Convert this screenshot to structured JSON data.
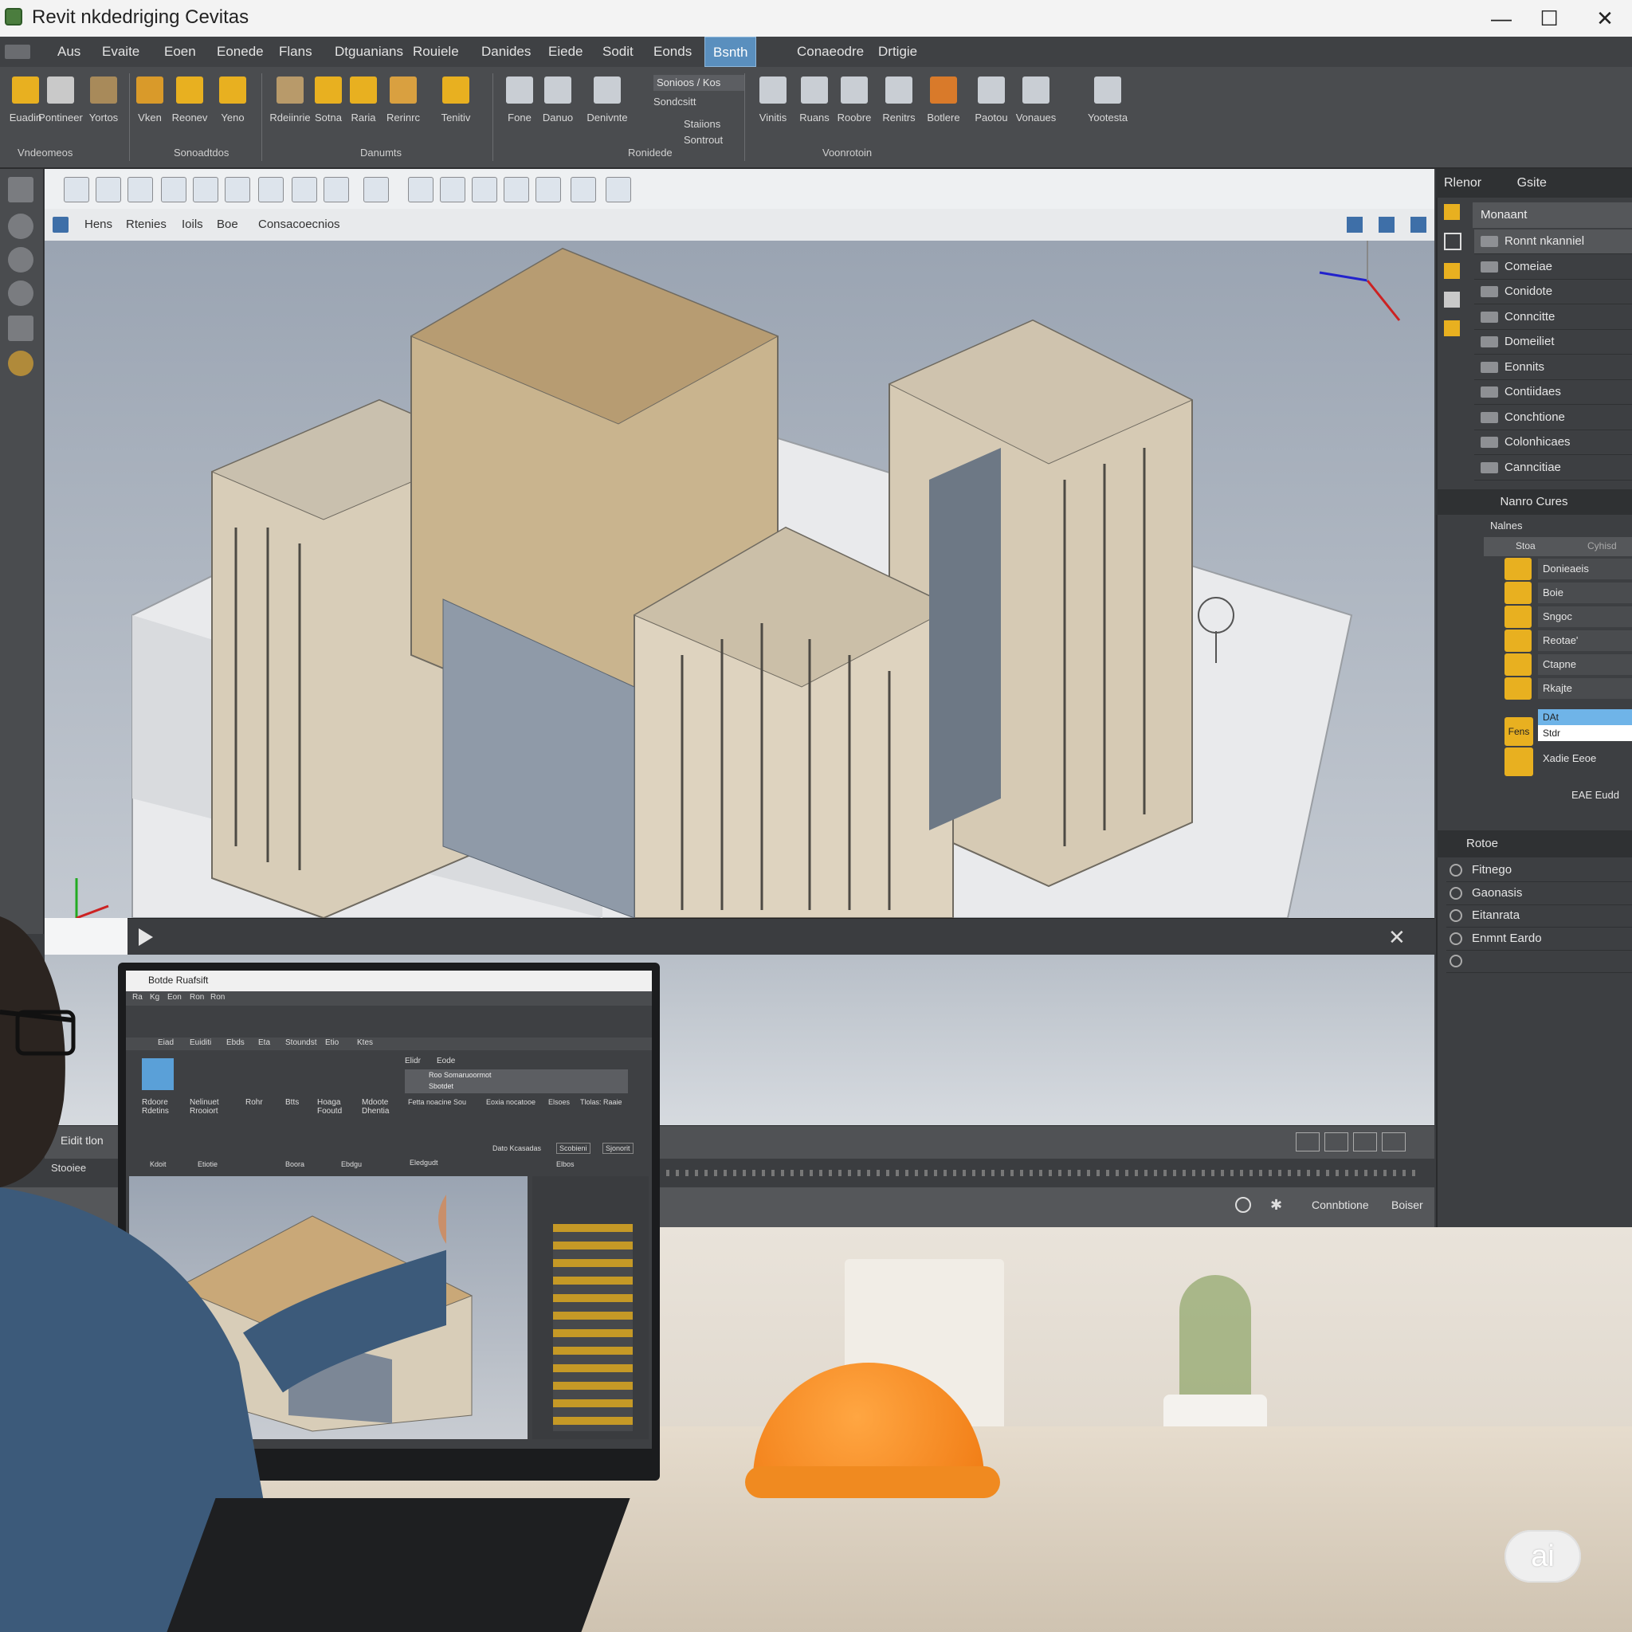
{
  "window": {
    "title": "Revit nkdedriging Cevitas",
    "controls": {
      "minimize": "—",
      "maximize": "☐",
      "close": "✕"
    }
  },
  "menu": {
    "items": [
      "Aus",
      "Evaite",
      "Eoen",
      "Eonede",
      "Flans",
      "Dtguanians",
      "Rouiele",
      "Danides",
      "Eiede",
      "Sodit",
      "Eonds",
      "Bsnth",
      "Conaeodre",
      "Drtigie"
    ],
    "active_index": 11
  },
  "ribbon": {
    "tools": [
      {
        "label": "Euadin",
        "color": "#e8b020"
      },
      {
        "label": "Pontineer",
        "color": "#c9c9c9"
      },
      {
        "label": "Yortos",
        "color": "#a88a5a"
      },
      {
        "label": "Vken",
        "color": "#d99a2a"
      },
      {
        "label": "Reonev",
        "color": "#e8b020"
      },
      {
        "label": "Yeno",
        "color": "#e8b020"
      },
      {
        "label": "Rdeiinrie",
        "color": "#b89a6a"
      },
      {
        "label": "Sotna",
        "color": "#e8b020"
      },
      {
        "label": "Raria",
        "color": "#e8b020"
      },
      {
        "label": "Rerinrc",
        "color": "#d9a040"
      },
      {
        "label": "Tenitiv",
        "color": "#e8b020"
      },
      {
        "label": "Fone",
        "color": "#c9ced4"
      },
      {
        "label": "Danuo",
        "color": "#c9ced4"
      },
      {
        "label": "Denivnte",
        "color": "#c9ced4"
      },
      {
        "label": "Vinitis",
        "color": "#c9ced4"
      },
      {
        "label": "Ruans",
        "color": "#c9ced4"
      },
      {
        "label": "Roobre",
        "color": "#c9ced4"
      },
      {
        "label": "Renitrs",
        "color": "#c9ced4"
      },
      {
        "label": "Botlere",
        "color": "#d97a2a"
      },
      {
        "label": "Paotou",
        "color": "#c9ced4"
      },
      {
        "label": "Vonaues",
        "color": "#c9ced4"
      },
      {
        "label": "Yootesta",
        "color": "#c9ced4"
      }
    ],
    "side_labels": [
      "Sonioos / Kos",
      "Sondcsitt",
      "Staiions",
      "Sontrout"
    ],
    "groups": [
      "Vndeomeos",
      "Sonoadtdos",
      "Danumts",
      "Ronidede",
      "Voonrotoin"
    ]
  },
  "view": {
    "tabs": [
      "Hens",
      "Rtenies",
      "Ioils",
      "Boe",
      "Consacoecnios"
    ]
  },
  "right_panel": {
    "header": [
      "Rlenor",
      "Gsite"
    ],
    "section1_title": "Monaant",
    "section1_items": [
      "Ronnt nkanniel",
      "Comeiae",
      "Conidote",
      "Conncitte",
      "Domeiliet",
      "Eonnits",
      "Contiidaes",
      "Conchtione",
      "Colonhicaes",
      "Canncitiae"
    ],
    "section2_title": "Nanro Cures",
    "section2_subtitle": "Nalnes",
    "section2_columns": [
      "Stoa",
      "Cyhisd"
    ],
    "layers": [
      "Donieaeis",
      "Boie",
      "Sngoc",
      "Reotae'",
      "Ctapne",
      "Rkajte"
    ],
    "layer_inputs": [
      "DAt",
      "Stdr"
    ],
    "layer_last": "Xadie Eeoe",
    "fens_label": "Fens",
    "section2_footer": "EAE Eudd",
    "section3_title": "Rotoe",
    "section3_items": [
      "Fitnego",
      "Gaonasis",
      "Eitanrata",
      "Enmnt Eardo"
    ]
  },
  "status": {
    "left": "Eidit tlon",
    "left2": "Stooiee",
    "right": [
      "Connbtione",
      "Boiser"
    ]
  },
  "secondary_window": {
    "title": "Botde Ruafsift",
    "menu": [
      "Ra",
      "Kg",
      "Eon",
      "Ron",
      "Ron"
    ],
    "tabs": [
      "Eiad",
      "Euiditi",
      "Ebds",
      "Eta",
      "Stoundst",
      "Etio",
      "Ktes"
    ],
    "tools": [
      "Rdoore Rdetins",
      "Nelinuet Rrooiort",
      "Rohr",
      "Btts",
      "Hoaga Fooutd",
      "Mdoote Dhentia"
    ],
    "panel_header": [
      "Elidr",
      "Eode"
    ],
    "panel_row": "Roo Somaruoormot",
    "panel_sub": "Sbotdet",
    "panel_cols": [
      "Fetta noacine Sou",
      "Eoxia nocatooe",
      "Elsoes",
      "Tlolas: Raaie"
    ],
    "panel_buttons": [
      "Dato Kcasadas",
      "Scobieni",
      "Sjonorit"
    ],
    "groups": [
      "Kdoit",
      "Etiotie",
      "Boora",
      "Ebdgu"
    ],
    "footer": [
      "Eledgudt",
      "Elbos"
    ]
  },
  "badge": "ai"
}
